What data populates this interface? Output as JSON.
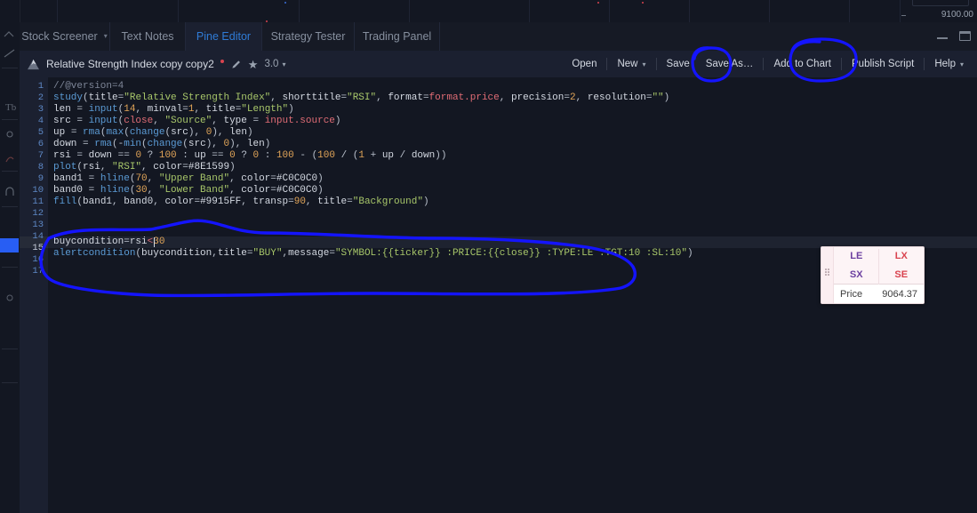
{
  "chart": {
    "axis_price": "9100.00"
  },
  "tabs": [
    {
      "label": "Stock Screener",
      "caret": "▾",
      "active": false
    },
    {
      "label": "Text Notes",
      "caret": "",
      "active": false
    },
    {
      "label": "Pine Editor",
      "caret": "",
      "active": true
    },
    {
      "label": "Strategy Tester",
      "caret": "",
      "active": false
    },
    {
      "label": "Trading Panel",
      "caret": "",
      "active": false
    }
  ],
  "window_controls": {
    "minimize": "minimize-icon",
    "maximize": "maximize-icon"
  },
  "scriptbar": {
    "logo": "mountain-logo-icon",
    "title": "Relative Strength Index copy copy2",
    "unsaved_dot": "unsaved-indicator",
    "rename_icon": "pencil-icon",
    "favorite_icon": "star-icon",
    "version": "3.0",
    "version_caret": "▾",
    "buttons": [
      {
        "label": "Open",
        "caret": ""
      },
      {
        "label": "New",
        "caret": "▾"
      },
      {
        "label": "Save",
        "caret": ""
      },
      {
        "label": "Save As…",
        "caret": ""
      },
      {
        "label": "Add to Chart",
        "caret": ""
      },
      {
        "label": "Publish Script",
        "caret": ""
      },
      {
        "label": "Help",
        "caret": "▾"
      }
    ]
  },
  "editor": {
    "current_line": 15,
    "line_numbers": [
      1,
      2,
      3,
      4,
      5,
      6,
      7,
      8,
      9,
      10,
      11,
      12,
      13,
      14,
      15,
      16,
      17
    ],
    "code": [
      "//@version=4",
      "study(title=\"Relative Strength Index\", shorttitle=\"RSI\", format=format.price, precision=2, resolution=\"\")",
      "len = input(14, minval=1, title=\"Length\")",
      "src = input(close, \"Source\", type = input.source)",
      "up = rma(max(change(src), 0), len)",
      "down = rma(-min(change(src), 0), len)",
      "rsi = down == 0 ? 100 : up == 0 ? 0 : 100 - (100 / (1 + up / down))",
      "plot(rsi, \"RSI\", color=#8E1599)",
      "band1 = hline(70, \"Upper Band\", color=#C0C0C0)",
      "band0 = hline(30, \"Lower Band\", color=#C0C0C0)",
      "fill(band1, band0, color=#9915FF, transp=90, title=\"Background\")",
      "",
      "",
      "",
      "buycondition=rsi<30",
      "alertcondition(buycondition,title=\"BUY\",message=\"SYMBOL:{{ticker}} :PRICE:{{close}} :TYPE:LE :TGT:10 :SL:10\")",
      ""
    ]
  },
  "price_widget": {
    "buttons": [
      "LE",
      "LX",
      "SX",
      "SE"
    ],
    "price_label": "Price",
    "price_value": "9064.37"
  },
  "annotations": {
    "color": "#1414ff",
    "shapes": [
      "circle-save-button",
      "circle-add-to-chart-button",
      "oval-around-alert-code"
    ]
  }
}
